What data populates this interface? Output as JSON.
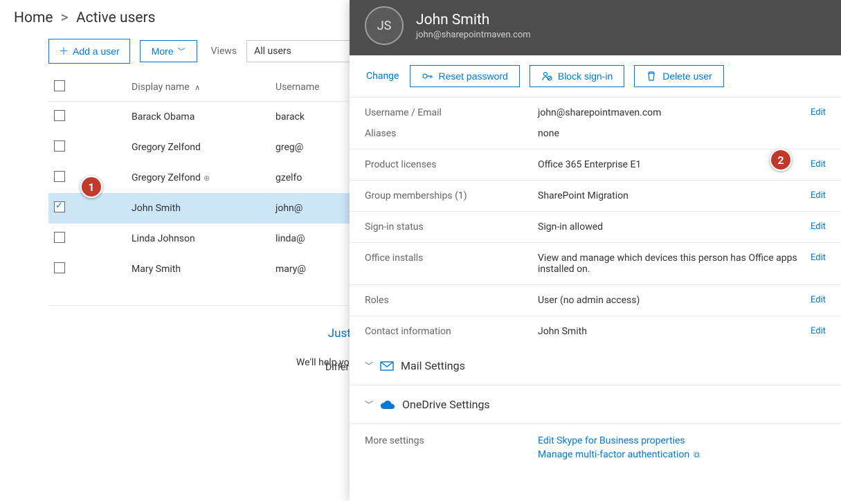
{
  "breadcrumb": {
    "root": "Home",
    "current": "Active users"
  },
  "toolbar": {
    "add_user": "Add a user",
    "more": "More",
    "views_label": "Views",
    "views_value": "All users"
  },
  "columns": {
    "display_name": "Display name",
    "username": "Username"
  },
  "users": [
    {
      "name": "Barack Obama",
      "user": "barack",
      "selected": false
    },
    {
      "name": "Gregory Zelfond",
      "user": "greg@",
      "selected": false
    },
    {
      "name": "Gregory Zelfond",
      "user": "gzelfo",
      "selected": false,
      "dup": true
    },
    {
      "name": "John Smith",
      "user": "john@",
      "selected": true
    },
    {
      "name": "Linda Johnson",
      "user": "linda@",
      "selected": false
    },
    {
      "name": "Mary Smith",
      "user": "mary@",
      "selected": false
    }
  ],
  "help": {
    "heading": "Just want to add an email address?",
    "body": "We'll help you select the right option based on your needs.",
    "col2": "Different"
  },
  "panel": {
    "initials": "JS",
    "title": "John Smith",
    "subtitle": "john@sharepointmaven.com",
    "change": "Change",
    "reset_pw": "Reset password",
    "block": "Block sign-in",
    "delete": "Delete user",
    "edit": "Edit",
    "rows": {
      "username": {
        "label": "Username / Email",
        "value": "john@sharepointmaven.com",
        "edit": true
      },
      "aliases": {
        "label": "Aliases",
        "value": "none",
        "edit": false
      },
      "licenses": {
        "label": "Product licenses",
        "value": "Office 365 Enterprise E1",
        "edit": true
      },
      "groups": {
        "label": "Group memberships (1)",
        "value": "SharePoint Migration",
        "edit": true
      },
      "signin": {
        "label": "Sign-in status",
        "value": "Sign-in allowed",
        "edit": true
      },
      "installs": {
        "label": "Office installs",
        "value": "View and manage which devices this person has Office apps installed on.",
        "edit": true
      },
      "roles": {
        "label": "Roles",
        "value": "User (no admin access)",
        "edit": true
      },
      "contact": {
        "label": "Contact information",
        "value": "John Smith",
        "edit": true
      }
    },
    "sections": {
      "mail": "Mail Settings",
      "onedrive": "OneDrive Settings"
    },
    "more": {
      "label": "More settings",
      "skype": "Edit Skype for Business properties",
      "mfa": "Manage multi-factor authentication"
    }
  },
  "callouts": {
    "one": "1",
    "two": "2"
  }
}
